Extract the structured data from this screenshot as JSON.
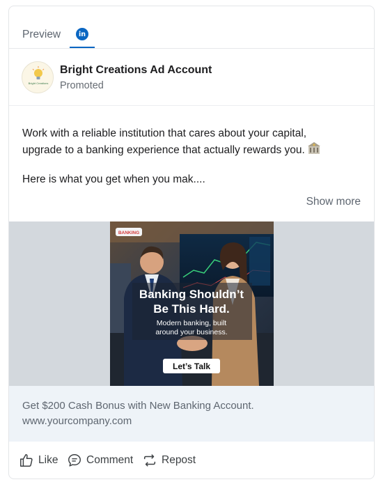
{
  "tabs": {
    "preview_label": "Preview",
    "linkedin_badge": "in"
  },
  "account": {
    "name": "Bright Creations Ad Account",
    "subtitle": "Promoted",
    "logo_text": "Bright Creations"
  },
  "post": {
    "line1": "Work with a reliable institution that cares about your capital,",
    "line2": "upgrade to a banking experience that actually rewards you.",
    "line3": "Here is what you get when you mak....",
    "show_more": "Show more"
  },
  "creative": {
    "tag": "BANKING",
    "headline_line1": "Banking Shouldn’t",
    "headline_line2": "Be This Hard.",
    "sub_line1": "Modern banking, built",
    "sub_line2": "around your business.",
    "cta": "Let’s Talk"
  },
  "link_card": {
    "title": "Get $200 Cash Bonus with New Banking Account.",
    "url": "www.yourcompany.com"
  },
  "actions": {
    "like": "Like",
    "comment": "Comment",
    "repost": "Repost"
  },
  "colors": {
    "linkedin_blue": "#0a66c2",
    "caption_bg": "#eef3f8",
    "media_bg": "#d3d8dd"
  }
}
